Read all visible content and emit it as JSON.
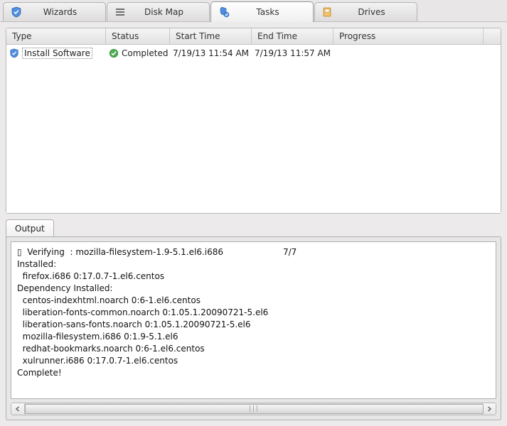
{
  "tabs": [
    {
      "label": "Wizards",
      "icon": "shield-blue-icon",
      "active": false
    },
    {
      "label": "Disk Map",
      "icon": "list-lines-icon",
      "active": false
    },
    {
      "label": "Tasks",
      "icon": "tasks-icon",
      "active": true
    },
    {
      "label": "Drives",
      "icon": "drive-icon",
      "active": false
    }
  ],
  "task_grid": {
    "columns": {
      "type": "Type",
      "status": "Status",
      "start": "Start Time",
      "end": "End Time",
      "progress": "Progress"
    },
    "rows": [
      {
        "icon": "shield-blue-icon",
        "type": "Install Software",
        "status_icon": "ok-green-icon",
        "status": "Completed",
        "start": "7/19/13 11:54 AM",
        "end": "7/19/13 11:57 AM",
        "progress": ""
      }
    ]
  },
  "output": {
    "tab_label": "Output",
    "text": "▯  Verifying  : mozilla-filesystem-1.9-5.1.el6.i686                      7/7\nInstalled:\n  firefox.i686 0:17.0.7-1.el6.centos\nDependency Installed:\n  centos-indexhtml.noarch 0:6-1.el6.centos\n  liberation-fonts-common.noarch 0:1.05.1.20090721-5.el6\n  liberation-sans-fonts.noarch 0:1.05.1.20090721-5.el6\n  mozilla-filesystem.i686 0:1.9-5.1.el6\n  redhat-bookmarks.noarch 0:6-1.el6.centos\n  xulrunner.i686 0:17.0.7-1.el6.centos\nComplete!"
  }
}
